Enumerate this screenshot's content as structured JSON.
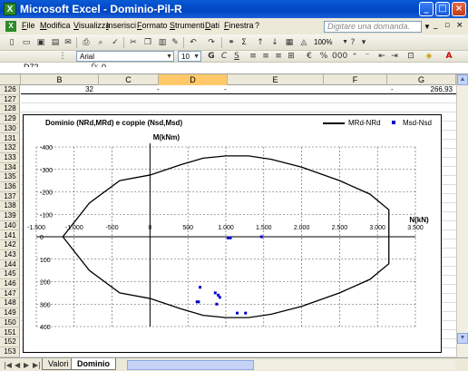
{
  "window": {
    "title": "Microsoft Excel - Dominio-Pil-R"
  },
  "menubar": {
    "items": [
      "File",
      "Modifica",
      "Visualizza",
      "Inserisci",
      "Formato",
      "Strumenti",
      "Dati",
      "Finestra",
      "?"
    ],
    "ask_placeholder": "Digitare una domanda."
  },
  "toolbar": {
    "zoom": "100%",
    "font_name": "Arial",
    "font_size": "10"
  },
  "formula": {
    "name_box": "D72",
    "fx": "fx",
    "value": "0"
  },
  "columns": [
    "B",
    "C",
    "D",
    "E",
    "F",
    "G"
  ],
  "rows": [
    "126",
    "127",
    "128",
    "129",
    "130",
    "131",
    "132",
    "133",
    "134",
    "135",
    "136",
    "137",
    "138",
    "139",
    "140",
    "141",
    "142",
    "143",
    "144",
    "145",
    "146",
    "147",
    "148",
    "149",
    "150",
    "151",
    "152",
    "153"
  ],
  "row126": {
    "b": "32",
    "c": "-",
    "d": "-",
    "f": "-",
    "g": "266,93"
  },
  "sheets": [
    "Valori",
    "Dominio"
  ],
  "chart_data": {
    "type": "scatter",
    "title": "Dominio (NRd,MRd) e coppie (Nsd,Msd)",
    "xlabel": "N(kN)",
    "ylabel": "M(kNm)",
    "xlim": [
      -1500,
      3500
    ],
    "ylim": [
      -400,
      400
    ],
    "y_reversed": true,
    "x_ticks": [
      "-1.500",
      "-1.000",
      "-500",
      "0",
      "500",
      "1.000",
      "1.500",
      "2.000",
      "2.500",
      "3.000",
      "3.500"
    ],
    "y_ticks": [
      "-400",
      "-300",
      "-200",
      "-100",
      "0",
      "100",
      "200",
      "300",
      "400"
    ],
    "grid": true,
    "legend": {
      "placement": "top-right",
      "entries": [
        "MRd-NRd",
        "Msd-Nsd"
      ]
    },
    "series": [
      {
        "name": "MRd-NRd",
        "style": "line",
        "color": "#000000",
        "x": [
          -1150,
          -800,
          -400,
          0,
          400,
          700,
          1000,
          1300,
          1600,
          2000,
          2500,
          2900,
          3150,
          3150,
          2900,
          2500,
          2000,
          1600,
          1300,
          1000,
          700,
          400,
          0,
          -400,
          -800,
          -1150
        ],
        "y": [
          0,
          -150,
          -250,
          -275,
          -320,
          -350,
          -360,
          -360,
          -345,
          -310,
          -250,
          -190,
          -120,
          120,
          190,
          250,
          310,
          345,
          360,
          360,
          350,
          320,
          275,
          250,
          150,
          0
        ]
      },
      {
        "name": "Msd-Nsd",
        "style": "markers",
        "color": "#0000cc",
        "x": [
          1030,
          1060,
          1470,
          660,
          640,
          860,
          900,
          920,
          880,
          1150,
          1260,
          620
        ],
        "y": [
          5,
          5,
          0,
          225,
          290,
          250,
          260,
          270,
          300,
          340,
          340,
          290
        ]
      }
    ]
  }
}
